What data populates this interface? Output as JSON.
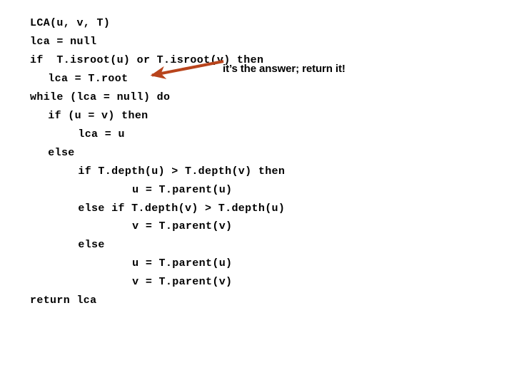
{
  "slide": {
    "background_color": "#ffffff",
    "code": {
      "font": "monospace-bold",
      "color": "#000000",
      "lines": [
        {
          "text": "LCA(u, v, T)",
          "indent": 0
        },
        {
          "text": "lca = null",
          "indent": 0
        },
        {
          "text": "if  T.isroot(u) or T.isroot(v) then",
          "indent": 0
        },
        {
          "text": "lca = T.root",
          "indent": 3
        },
        {
          "text": "while (lca = null) do",
          "indent": 0
        },
        {
          "text": "if (u = v) then",
          "indent": 3
        },
        {
          "text": "lca = u",
          "indent": 8
        },
        {
          "text": "else",
          "indent": 3
        },
        {
          "text": "if T.depth(u) > T.depth(v) then",
          "indent": 8
        },
        {
          "text": "u = T.parent(u)",
          "indent": 17
        },
        {
          "text": "else if T.depth(v) > T.depth(u)",
          "indent": 8
        },
        {
          "text": "v = T.parent(v)",
          "indent": 17
        },
        {
          "text": "else",
          "indent": 8
        },
        {
          "text": "u = T.parent(u)",
          "indent": 17
        },
        {
          "text": "v = T.parent(v)",
          "indent": 17
        },
        {
          "text": "return lca",
          "indent": 0
        }
      ]
    },
    "annotation": {
      "text": "it’s the answer; return it!",
      "color": "#000000",
      "arrow_color": "#B8441C",
      "arrow_points_to_line_index": 3
    }
  }
}
